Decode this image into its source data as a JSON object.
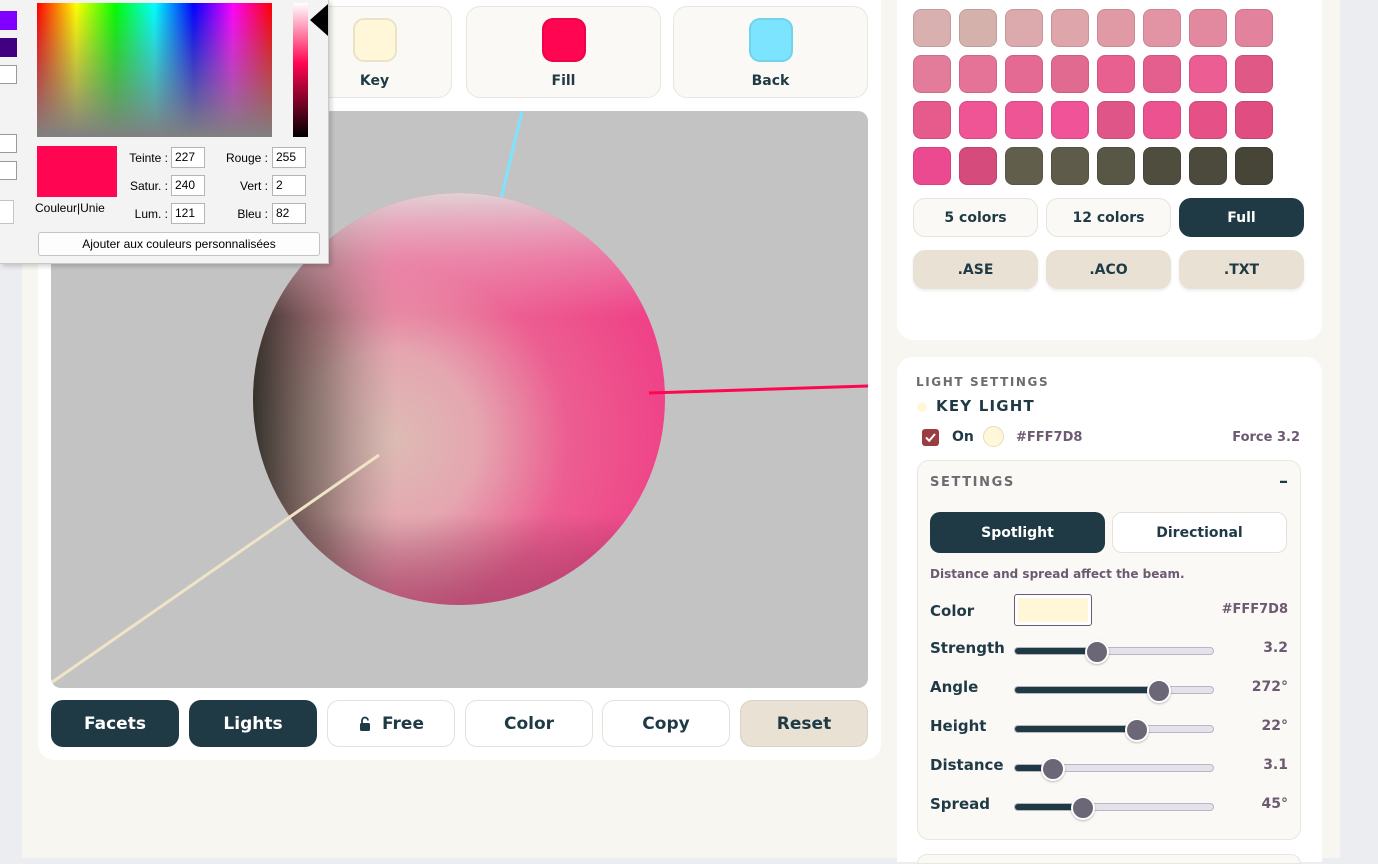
{
  "light_cards": [
    {
      "label": "Key",
      "color": "#FFF7D8"
    },
    {
      "label": "Fill",
      "color": "#FF0552"
    },
    {
      "label": "Back",
      "color": "#7CE4FF"
    }
  ],
  "toolbar": {
    "facets": "Facets",
    "lights": "Lights",
    "free": "Free",
    "color": "Color",
    "copy": "Copy",
    "reset": "Reset"
  },
  "palette": {
    "swatches": [
      "#d9b0b0",
      "#d4b2ab",
      "#dcaaad",
      "#dea5aa",
      "#e09aa5",
      "#e294a4",
      "#e289a0",
      "#e3829c",
      "#e27c9a",
      "#e57397",
      "#e56a93",
      "#e16a90",
      "#e8608f",
      "#e55f8e",
      "#eb5d93",
      "#e05885",
      "#e65b8c",
      "#ef5495",
      "#ed5595",
      "#f05398",
      "#e05587",
      "#ec5290",
      "#e55086",
      "#df4d81",
      "#ec4a90",
      "#d44b7c",
      "#615f4c",
      "#5e5b4a",
      "#585645",
      "#4f4d3e",
      "#4c4a3c",
      "#464538"
    ],
    "count_buttons": [
      "5 colors",
      "12 colors",
      "Full"
    ],
    "export_buttons": [
      ".ASE",
      ".ACO",
      ".TXT"
    ]
  },
  "light_settings": {
    "section_title": "LIGHT SETTINGS",
    "key_title": "KEY LIGHT",
    "on_label": "On",
    "on_hex": "#FFF7D8",
    "force": "Force 3.2",
    "settings_title": "SETTINGS",
    "collapse": "–",
    "mode_spotlight": "Spotlight",
    "mode_directional": "Directional",
    "hint": "Distance and spread affect the beam.",
    "color_label": "Color",
    "color_hex": "#FFF7D8",
    "sliders": [
      {
        "label": "Strength",
        "value": "3.2",
        "fraction": 0.41
      },
      {
        "label": "Angle",
        "value": "272°",
        "fraction": 0.72
      },
      {
        "label": "Height",
        "value": "22°",
        "fraction": 0.61
      },
      {
        "label": "Distance",
        "value": "3.1",
        "fraction": 0.19
      },
      {
        "label": "Spread",
        "value": "45°",
        "fraction": 0.34
      }
    ]
  },
  "color_dialog": {
    "hue_label": "Teinte :",
    "hue": "227",
    "sat_label": "Satur. :",
    "sat": "240",
    "lum_label": "Lum. :",
    "lum": "121",
    "red_label": "Rouge :",
    "red": "255",
    "green_label": "Vert :",
    "green": "2",
    "blue_label": "Bleu :",
    "blue": "82",
    "preview_label": "Couleur|Unie",
    "add_button": "Ajouter aux couleurs personnalisées",
    "current_color": "#FF0552"
  }
}
